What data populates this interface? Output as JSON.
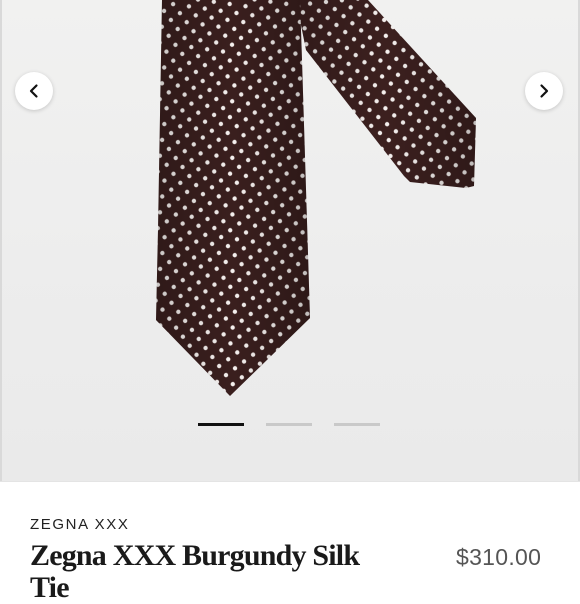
{
  "gallery": {
    "image_alt": "Burgundy silk tie with white polka dots",
    "slide_count": 3,
    "active_slide": 1
  },
  "product": {
    "brand": "ZEGNA XXX",
    "title": "Zegna XXX Burgundy Silk Tie",
    "price": "$310.00"
  },
  "icons": {
    "prev": "chevron-left-icon",
    "next": "chevron-right-icon"
  },
  "colors": {
    "tie": "#3a1f1e",
    "dot": "#f5f0ee",
    "indicator_active": "#111111",
    "indicator_inactive": "#c9c9c9"
  }
}
